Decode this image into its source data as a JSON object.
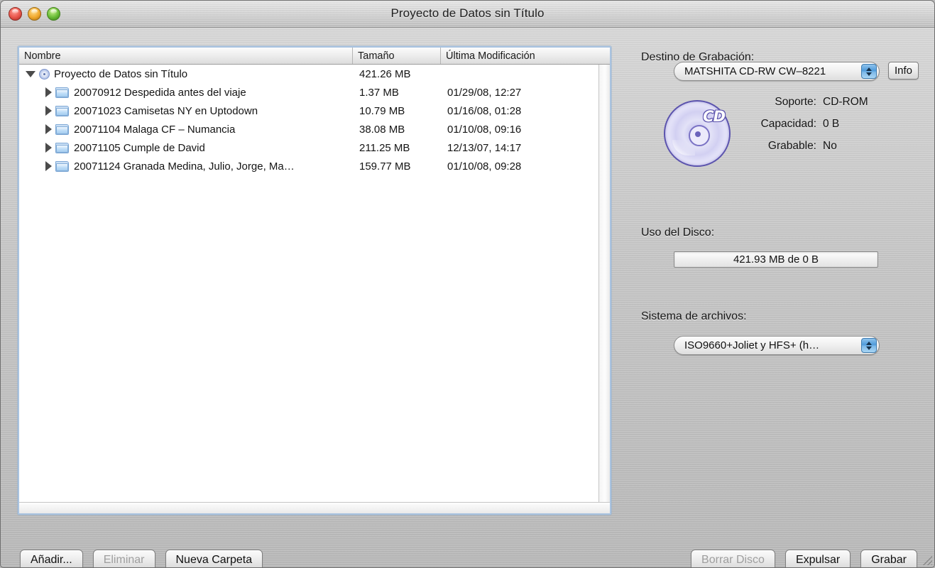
{
  "window": {
    "title": "Proyecto de Datos sin Título",
    "traffic": {
      "close": "close-button",
      "minimize": "minimize-button",
      "zoom": "zoom-button"
    }
  },
  "file_list": {
    "columns": {
      "name": "Nombre",
      "size": "Tamaño",
      "modified": "Última Modificación"
    },
    "rows": [
      {
        "name": "Proyecto de Datos sin Título",
        "size": "421.26 MB",
        "modified": "",
        "level": 0,
        "expanded": true,
        "icon": "disc-icon"
      },
      {
        "name": "20070912 Despedida antes del viaje",
        "size": "1.37 MB",
        "modified": "01/29/08, 12:27",
        "level": 1,
        "expanded": false,
        "icon": "folder-icon"
      },
      {
        "name": "20071023 Camisetas NY en Uptodown",
        "size": "10.79 MB",
        "modified": "01/16/08, 01:28",
        "level": 1,
        "expanded": false,
        "icon": "folder-icon"
      },
      {
        "name": "20071104 Malaga CF – Numancia",
        "size": "38.08 MB",
        "modified": "01/10/08, 09:16",
        "level": 1,
        "expanded": false,
        "icon": "folder-icon"
      },
      {
        "name": "20071105 Cumple de David",
        "size": "211.25 MB",
        "modified": "12/13/07, 14:17",
        "level": 1,
        "expanded": false,
        "icon": "folder-icon"
      },
      {
        "name": "20071124 Granada Medina, Julio, Jorge, Ma…",
        "size": "159.77 MB",
        "modified": "01/10/08, 09:28",
        "level": 1,
        "expanded": false,
        "icon": "folder-icon"
      }
    ]
  },
  "panel": {
    "burn_target_label": "Destino de Grabación:",
    "burn_target_value": "MATSHITA CD-RW CW–8221",
    "info_button": "Info",
    "media": [
      {
        "key": "Soporte:",
        "value": "CD-ROM"
      },
      {
        "key": "Capacidad:",
        "value": "0 B"
      },
      {
        "key": "Grabable:",
        "value": "No"
      }
    ],
    "disc_label": "CD",
    "disk_usage_label": "Uso del Disco:",
    "disk_usage_value": "421.93 MB de 0 B",
    "filesystem_label": "Sistema de archivos:",
    "filesystem_value": "ISO9660+Joliet y HFS+ (h…"
  },
  "buttons": {
    "add": "Añadir...",
    "remove": "Eliminar",
    "new_folder": "Nueva Carpeta",
    "erase_disc": "Borrar Disco",
    "eject": "Expulsar",
    "burn": "Grabar"
  },
  "colors": {
    "focus_ring": "#a9c3e0",
    "stepper_blue": "#4f9bdb",
    "disc_purple": "#5b53ad",
    "folder_blue": "#a9cdf0",
    "disabled_text": "#9e9e9e"
  }
}
